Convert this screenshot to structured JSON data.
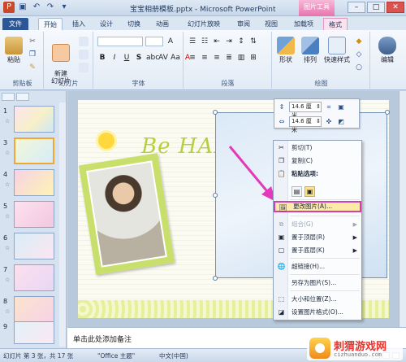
{
  "window": {
    "title": "宝宝相册模板.pptx - Microsoft PowerPoint",
    "context_tool": "图片工具"
  },
  "tabs": [
    "文件",
    "开始",
    "插入",
    "设计",
    "切换",
    "动画",
    "幻灯片放映",
    "审阅",
    "视图",
    "加载项",
    "格式"
  ],
  "ribbon": {
    "clipboard": {
      "label": "剪贴板",
      "paste": "粘贴"
    },
    "slides": {
      "label": "幻灯片",
      "new_slide": "新建\n幻灯片"
    },
    "font": {
      "label": "字体"
    },
    "paragraph": {
      "label": "段落"
    },
    "drawing": {
      "label": "绘图",
      "shapes": "形状",
      "arrange": "排列",
      "quick_styles": "快速样式"
    },
    "editing": {
      "label": "编辑"
    }
  },
  "slides_panel": {
    "slides": [
      "1",
      "2",
      "3",
      "4",
      "5",
      "6",
      "7",
      "8",
      "9"
    ],
    "current": "3"
  },
  "mini_toolbar": {
    "height": "14.6 厘米",
    "width": "14.6 厘米"
  },
  "context_menu": {
    "items": [
      {
        "label": "剪切(T)",
        "icon": "scissors-icon",
        "enabled": true
      },
      {
        "label": "复制(C)",
        "icon": "copy-icon",
        "enabled": true
      },
      {
        "label": "粘贴选项:",
        "icon": "paste-icon",
        "enabled": true
      },
      {
        "label": "更改图片(A)...",
        "icon": "change-picture-icon",
        "enabled": true,
        "highlighted": true
      },
      {
        "label": "组合(G)",
        "icon": "group-icon",
        "enabled": false
      },
      {
        "label": "置于顶层(R)",
        "icon": "bring-front-icon",
        "enabled": true
      },
      {
        "label": "置于底层(K)",
        "icon": "send-back-icon",
        "enabled": true
      },
      {
        "label": "超链接(H)...",
        "icon": "hyperlink-icon",
        "enabled": true
      },
      {
        "label": "另存为图片(S)...",
        "icon": "save-picture-icon",
        "enabled": true
      },
      {
        "label": "大小和位置(Z)...",
        "icon": "size-position-icon",
        "enabled": true
      },
      {
        "label": "设置图片格式(O)...",
        "icon": "format-picture-icon",
        "enabled": true
      }
    ]
  },
  "slide_content": {
    "headline": "Be HAPPY."
  },
  "notes": {
    "placeholder": "单击此处添加备注"
  },
  "status": {
    "slide_info": "幻灯片 第 3 张，共 17 张",
    "theme": "\"Office 主题\"",
    "language": "中文(中国)"
  },
  "watermark": {
    "title": "刺猬游戏网",
    "url": "cizhuanduo.com"
  },
  "colors": {
    "file_tab": "#2b5797",
    "context_tool": "#e774ad",
    "highlight_border": "#d23fae",
    "arrow": "#e23ab8"
  }
}
